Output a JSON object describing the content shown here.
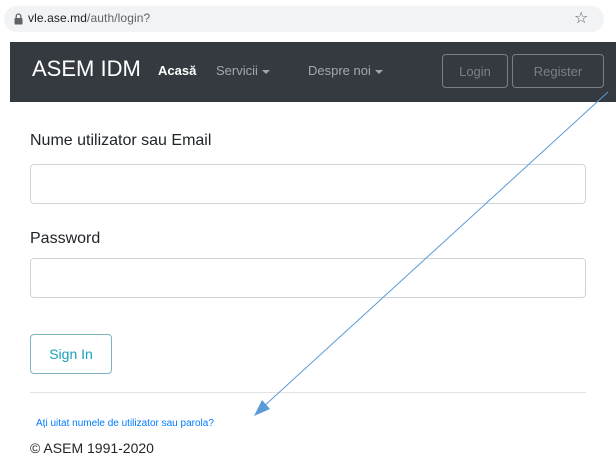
{
  "browser": {
    "url_host": "vle.ase.md",
    "url_path": "/auth/login?",
    "lock_icon": "lock-icon",
    "star_icon": "star-icon"
  },
  "navbar": {
    "brand": "ASEM IDM",
    "items": [
      {
        "label": "Acasă"
      },
      {
        "label": "Servicii"
      },
      {
        "label": "Despre noi"
      }
    ],
    "login_label": "Login",
    "register_label": "Register"
  },
  "form": {
    "username_label": "Nume utilizator sau Email",
    "username_value": "",
    "password_label": "Password",
    "password_value": "",
    "signin_label": "Sign In"
  },
  "footer": {
    "forgot_link": "Ați uitat numele de utilizator sau parola?",
    "copyright": "© ASEM 1991-2020"
  },
  "colors": {
    "navbar_bg": "#343a40",
    "link": "#007bff",
    "signin_text": "#17a2b8",
    "annotation_arrow": "#5b9bd5"
  }
}
